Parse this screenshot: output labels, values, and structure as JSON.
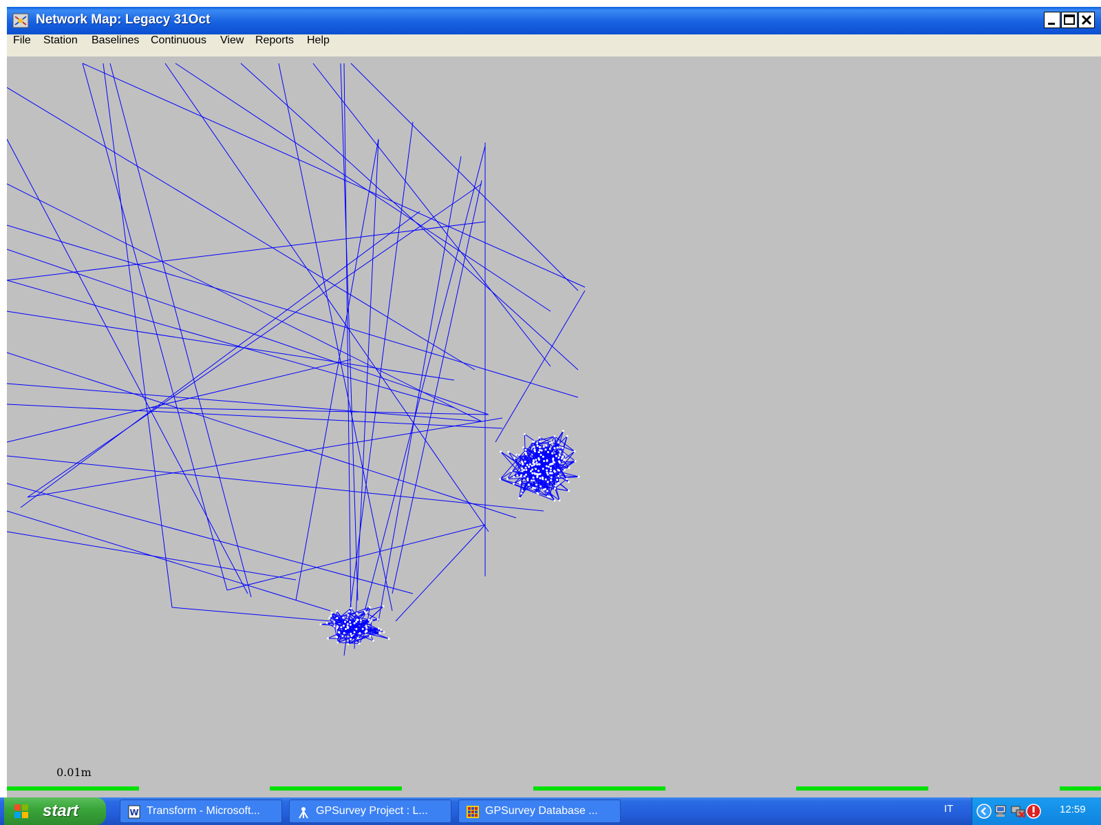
{
  "window": {
    "title": "Network Map: Legacy 31Oct"
  },
  "menu": [
    "File",
    "Station",
    "Baselines",
    "Continuous",
    "View",
    "Reports",
    "Help"
  ],
  "map": {
    "scale_label": "0.01m",
    "line_color": "#0000ff",
    "background": "#c0c0c0"
  },
  "taskbar": {
    "start_label": "start",
    "buttons": [
      {
        "label": "Transform - Microsoft...",
        "icon": "word-doc-icon"
      },
      {
        "label": "GPSurvey Project : L...",
        "icon": "gpsurvey-project-icon"
      },
      {
        "label": "GPSurvey Database ...",
        "icon": "gpsurvey-database-icon"
      }
    ],
    "language": "IT",
    "clock": "12:59"
  }
}
